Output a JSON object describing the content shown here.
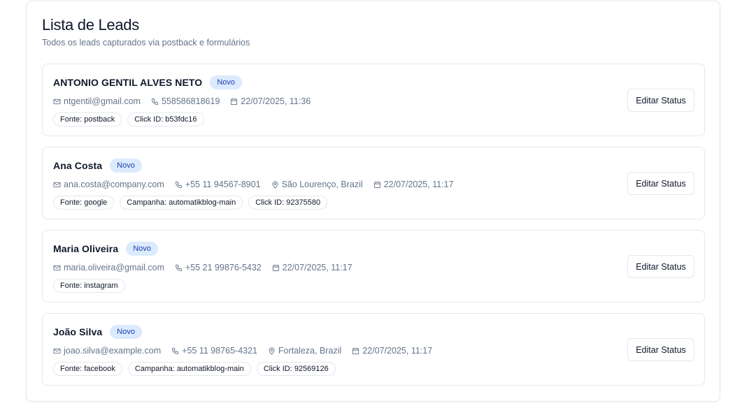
{
  "header": {
    "title": "Lista de Leads",
    "subtitle": "Todos os leads capturados via postback e formulários"
  },
  "leads": [
    {
      "name": "ANTONIO GENTIL ALVES NETO",
      "status": "Novo",
      "email": "ntgentil@gmail.com",
      "phone": "558586818619",
      "location": "",
      "date": "22/07/2025, 11:36",
      "source": "Fonte: postback",
      "campaign": "",
      "click_id": "Click ID: b53fdc16",
      "action_label": "Editar Status"
    },
    {
      "name": "Ana Costa",
      "status": "Novo",
      "email": "ana.costa@company.com",
      "phone": "+55 11 94567-8901",
      "location": "São Lourenço, Brazil",
      "date": "22/07/2025, 11:17",
      "source": "Fonte: google",
      "campaign": "Campanha: automatikblog-main",
      "click_id": "Click ID: 92375580",
      "action_label": "Editar Status"
    },
    {
      "name": "Maria Oliveira",
      "status": "Novo",
      "email": "maria.oliveira@gmail.com",
      "phone": "+55 21 99876-5432",
      "location": "",
      "date": "22/07/2025, 11:17",
      "source": "Fonte: instagram",
      "campaign": "",
      "click_id": "",
      "action_label": "Editar Status"
    },
    {
      "name": "João Silva",
      "status": "Novo",
      "email": "joao.silva@example.com",
      "phone": "+55 11 98765-4321",
      "location": "Fortaleza, Brazil",
      "date": "22/07/2025, 11:17",
      "source": "Fonte: facebook",
      "campaign": "Campanha: automatikblog-main",
      "click_id": "Click ID: 92569126",
      "action_label": "Editar Status"
    }
  ],
  "icons": {
    "email": "mail-icon",
    "phone": "phone-icon",
    "location": "map-pin-icon",
    "date": "calendar-icon"
  },
  "colors": {
    "badge_bg": "#dbeafe",
    "badge_text": "#1e40af",
    "muted_text": "#64748b",
    "border": "#e5e7eb"
  }
}
